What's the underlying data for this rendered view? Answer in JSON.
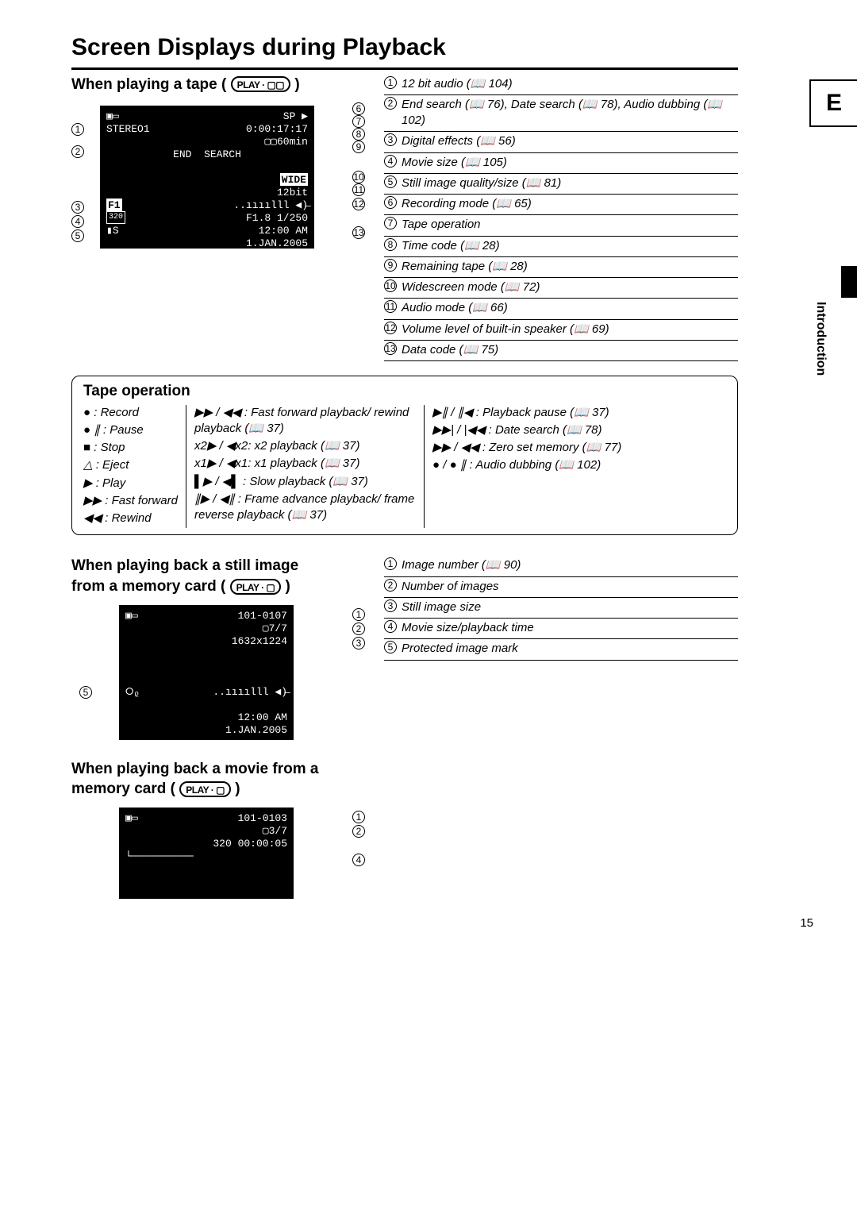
{
  "language_marker": "E",
  "side_section": "Introduction",
  "page_number": "15",
  "title": "Screen Displays during Playback",
  "sec1": {
    "heading_prefix": "When playing a tape (",
    "pill": "PLAY · ▢▢",
    "heading_suffix": " )",
    "screen": {
      "line1_left": "▣▭",
      "line1_right": "SP ▶",
      "line2_left": "STEREO1",
      "line2_right": "0:00:17:17",
      "line3_right": "▢▢60min",
      "line4_center": "END  SEARCH",
      "line5_right": "WIDE",
      "line6_right": "12bit",
      "line7_left": "F1",
      "line7_right": "..ıııılll ◀)̶",
      "line8_left": "320",
      "line8_mid": "F1.8 1/250",
      "line9_left": "▮S",
      "line9_mid": "12:00 AM",
      "line10_mid": "1.JAN.2005"
    },
    "left_callouts": [
      "1",
      "2",
      "3",
      "4",
      "5"
    ],
    "right_callouts": [
      "6",
      "7",
      "8",
      "9",
      "10",
      "11",
      "12",
      "13"
    ],
    "defs": [
      {
        "n": "1",
        "t": "12 bit audio (📖 104)"
      },
      {
        "n": "2",
        "t": "End search (📖 76), Date search (📖 78), Audio dubbing (📖 102)"
      },
      {
        "n": "3",
        "t": "Digital effects (📖 56)"
      },
      {
        "n": "4",
        "t": "Movie size (📖 105)"
      },
      {
        "n": "5",
        "t": "Still image quality/size (📖 81)"
      },
      {
        "n": "6",
        "t": "Recording mode (📖 65)"
      },
      {
        "n": "7",
        "t": "Tape operation"
      },
      {
        "n": "8",
        "t": "Time code (📖 28)"
      },
      {
        "n": "9",
        "t": "Remaining tape (📖 28)"
      },
      {
        "n": "10",
        "t": "Widescreen mode (📖 72)"
      },
      {
        "n": "11",
        "t": "Audio mode (📖 66)"
      },
      {
        "n": "12",
        "t": "Volume level of built-in speaker (📖 69)"
      },
      {
        "n": "13",
        "t": "Data code (📖 75)"
      }
    ]
  },
  "tape": {
    "heading": "Tape operation",
    "c1": [
      "● : Record",
      "● ∥ : Pause",
      "■ : Stop",
      "△ : Eject",
      "▶ : Play",
      "▶▶ : Fast forward",
      "◀◀ : Rewind"
    ],
    "c2": [
      "▶▶ / ◀◀ : Fast forward playback/ rewind playback (📖 37)",
      "x2▶ / ◀x2: x2 playback  (📖 37)",
      "x1▶ / ◀x1: x1 playback  (📖 37)",
      "▌▶ / ◀▌ : Slow playback (📖 37)",
      "∥▶ / ◀∥ : Frame advance playback/ frame reverse playback (📖 37)"
    ],
    "c3": [
      "▶∥ / ∥◀ : Playback pause (📖 37)",
      "▶▶| / |◀◀ : Date search  (📖 78)",
      "▶▶ / ◀◀ : Zero set memory (📖 77)",
      "● / ● ∥ : Audio dubbing (📖 102)"
    ]
  },
  "sec2": {
    "heading_l1": "When playing back a still image",
    "heading_l2_prefix": "from a memory card (",
    "pill": "PLAY · ▢",
    "heading_l2_suffix": " )",
    "screen": {
      "line1_left": "▣▭",
      "line1_right": "101-0107",
      "line2_right": "▢7/7",
      "line3_right": "1632x1224",
      "line4_left": "⭘ᵨ",
      "line4_right": "..ıııılll ◀)̶",
      "line5_right": "12:00 AM",
      "line6_right": "1.JAN.2005"
    },
    "left_callouts": [
      "5"
    ],
    "right_callouts": [
      "1",
      "2",
      "3"
    ],
    "defs": [
      {
        "n": "1",
        "t": "Image number (📖 90)"
      },
      {
        "n": "2",
        "t": "Number of images"
      },
      {
        "n": "3",
        "t": "Still image size"
      },
      {
        "n": "4",
        "t": "Movie size/playback time"
      },
      {
        "n": "5",
        "t": "Protected image mark"
      }
    ]
  },
  "sec3": {
    "heading_l1": "When playing back a movie from a",
    "heading_l2_prefix": "memory card (",
    "pill": "PLAY · ▢",
    "heading_l2_suffix": " )",
    "screen": {
      "line1_left": "▣▭",
      "line1_right": "101-0103",
      "line2_right": "▢3/7",
      "line3_right": "320 00:00:05",
      "line4": "└──────────"
    },
    "right_callouts": [
      "1",
      "2",
      "4"
    ]
  }
}
